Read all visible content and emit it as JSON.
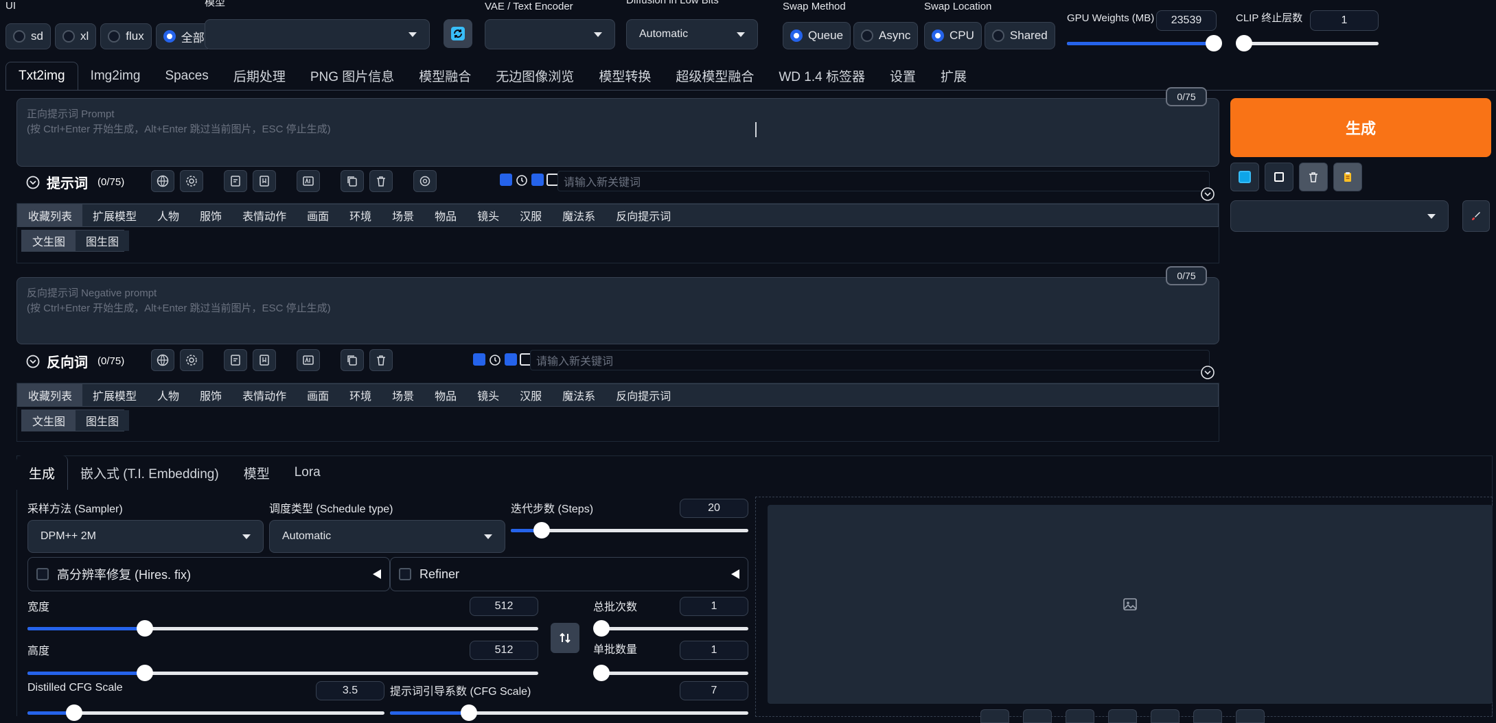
{
  "top": {
    "ui_label": "UI",
    "ui_options": [
      "sd",
      "xl",
      "flux",
      "全部"
    ],
    "ui_selected": "全部",
    "model_label": "模型",
    "vae_label": "VAE / Text Encoder",
    "diffusion_label": "Diffusion in Low Bits",
    "diffusion_value": "Automatic",
    "swap_method_label": "Swap Method",
    "swap_method_options": [
      "Queue",
      "Async"
    ],
    "swap_method_selected": "Queue",
    "swap_location_label": "Swap Location",
    "swap_location_options": [
      "CPU",
      "Shared"
    ],
    "swap_location_selected": "CPU",
    "gpu_weights_label": "GPU Weights (MB)",
    "gpu_weights_value": "23539",
    "gpu_weights_fraction": 0.99,
    "clip_label": "CLIP 终止层数",
    "clip_value": "1",
    "clip_fraction": 0.0
  },
  "main_tabs": [
    "Txt2img",
    "Img2img",
    "Spaces",
    "后期处理",
    "PNG 图片信息",
    "模型融合",
    "无边图像浏览",
    "模型转换",
    "超级模型融合",
    "WD 1.4 标签器",
    "设置",
    "扩展"
  ],
  "prompt": {
    "counter": "0/75",
    "placeholder_line1": "正向提示词 Prompt",
    "placeholder_line2": "(按 Ctrl+Enter 开始生成，Alt+Enter 跳过当前图片，ESC 停止生成)",
    "section_title": "提示词",
    "section_count": "(0/75)",
    "keyword_placeholder": "请输入新关键词"
  },
  "negative": {
    "counter": "0/75",
    "placeholder_line1": "反向提示词 Negative prompt",
    "placeholder_line2": "(按 Ctrl+Enter 开始生成，Alt+Enter 跳过当前图片，ESC 停止生成)",
    "section_title": "反向词",
    "section_count": "(0/75)",
    "keyword_placeholder": "请输入新关键词"
  },
  "categories": [
    "收藏列表",
    "扩展模型",
    "人物",
    "服饰",
    "表情动作",
    "画面",
    "环境",
    "场景",
    "物品",
    "镜头",
    "汉服",
    "魔法系",
    "反向提示词"
  ],
  "subtabs": [
    "文生图",
    "图生图"
  ],
  "generate_button": "生成",
  "gen_tabs": [
    "生成",
    "嵌入式 (T.I. Embedding)",
    "模型",
    "Lora"
  ],
  "sampler": {
    "label": "采样方法 (Sampler)",
    "value": "DPM++ 2M"
  },
  "schedule": {
    "label": "调度类型 (Schedule type)",
    "value": "Automatic"
  },
  "steps": {
    "label": "迭代步数 (Steps)",
    "value": "20",
    "fraction": 0.13
  },
  "hires": {
    "label": "高分辨率修复 (Hires. fix)"
  },
  "refiner": {
    "label": "Refiner"
  },
  "width": {
    "label": "宽度",
    "value": "512",
    "fraction": 0.23
  },
  "height": {
    "label": "高度",
    "value": "512",
    "fraction": 0.23
  },
  "batch_count": {
    "label": "总批次数",
    "value": "1",
    "fraction": 0.0
  },
  "batch_size": {
    "label": "单批数量",
    "value": "1",
    "fraction": 0.0
  },
  "distilled_cfg": {
    "label": "Distilled CFG Scale",
    "value": "3.5",
    "fraction": 0.13
  },
  "cfg": {
    "label": "提示词引导系数 (CFG Scale)",
    "value": "7",
    "fraction": 0.22
  },
  "icons": {
    "swap": "swap-vertical-icon",
    "refresh": "refresh-icon",
    "image_placeholder": "image-icon"
  },
  "colors": {
    "accent": "#2563eb",
    "generate": "#f97316",
    "background": "#0b0f19"
  }
}
